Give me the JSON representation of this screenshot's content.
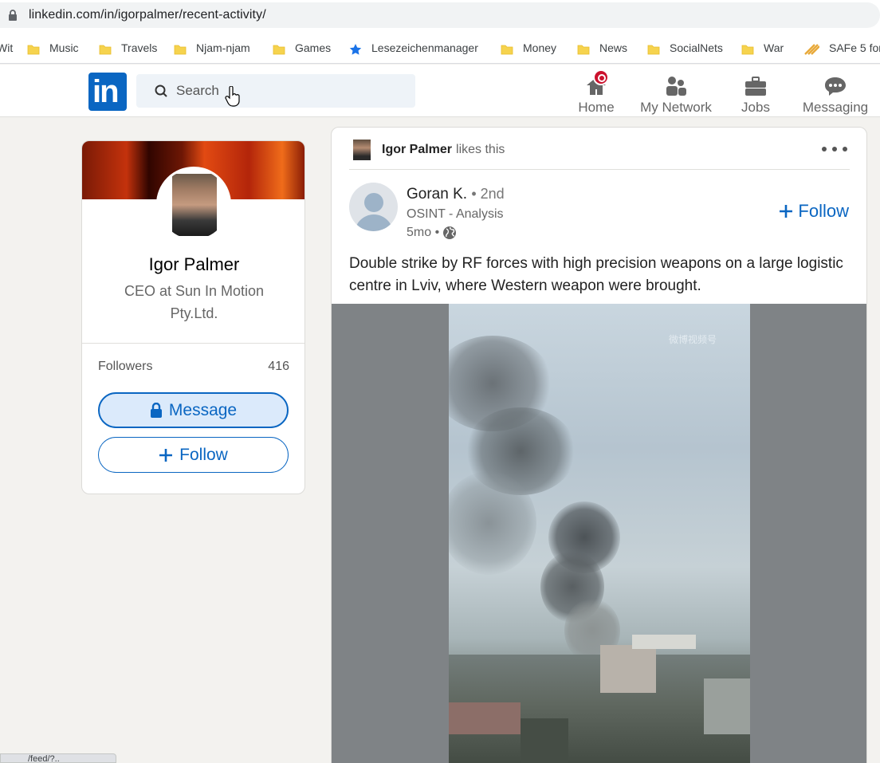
{
  "browser": {
    "url": "linkedin.com/in/igorpalmer/recent-activity/",
    "bookmarks": [
      {
        "label": "Wit",
        "icon": "folder-icon"
      },
      {
        "label": "Music",
        "icon": "folder-icon"
      },
      {
        "label": "Travels",
        "icon": "folder-icon"
      },
      {
        "label": "Njam-njam",
        "icon": "folder-icon"
      },
      {
        "label": "Games",
        "icon": "folder-icon"
      },
      {
        "label": "Lesezeichenmanager",
        "icon": "star-icon"
      },
      {
        "label": "Money",
        "icon": "folder-icon"
      },
      {
        "label": "News",
        "icon": "folder-icon"
      },
      {
        "label": "SocialNets",
        "icon": "folder-icon"
      },
      {
        "label": "War",
        "icon": "folder-icon"
      },
      {
        "label": "SAFe 5 for",
        "icon": "safe-icon"
      }
    ],
    "status_url": "/feed/?.."
  },
  "nav": {
    "logo": "in",
    "search_placeholder": "Search",
    "items": [
      {
        "label": "Home",
        "icon": "home-icon",
        "badge": true
      },
      {
        "label": "My Network",
        "icon": "network-icon"
      },
      {
        "label": "Jobs",
        "icon": "briefcase-icon"
      },
      {
        "label": "Messaging",
        "icon": "messaging-icon"
      }
    ],
    "accent": "#0a66c2",
    "badge_color": "#cb112d"
  },
  "profile": {
    "name": "Igor Palmer",
    "title": "CEO at Sun In Motion Pty.Ltd.",
    "followers_label": "Followers",
    "followers_count": "416",
    "message_button": "Message",
    "follow_button": "Follow"
  },
  "post": {
    "activity_actor": "Igor Palmer",
    "activity_text": "likes this",
    "author_name": "Goran K.",
    "author_degree": "• 2nd",
    "author_headline": "OSINT - Analysis",
    "author_time": "5mo •",
    "follow_label": "Follow",
    "text": "Double strike by RF forces with high precision weapons on a large logistic centre in Lviv, where Western weapon were brought.",
    "video_watermark": "微博视频号"
  }
}
